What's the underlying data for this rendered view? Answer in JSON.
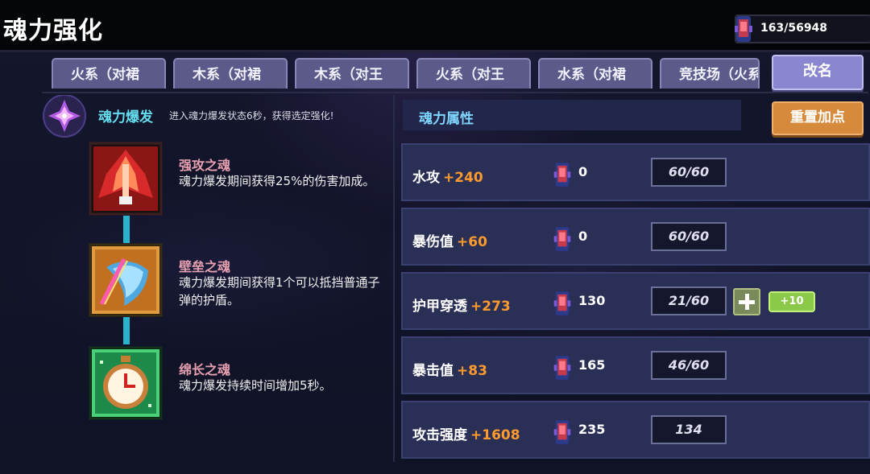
{
  "header": {
    "title": "魂力强化",
    "currency": "163/56948"
  },
  "tabs": [
    "火系（对裙",
    "木系（对裙",
    "木系（对王",
    "火系（对王",
    "水系（对裙",
    "竞技场（火系"
  ],
  "rename_label": "改名",
  "burst": {
    "label": "魂力爆发",
    "desc": "进入魂力爆发状态6秒，获得选定强化!"
  },
  "skills": [
    {
      "name": "强攻之魂",
      "desc": "魂力爆发期间获得25%的伤害加成。",
      "icon": "flame-ship-icon"
    },
    {
      "name": "壁垒之魂",
      "desc": "魂力爆发期间获得1个可以抵挡普通子弹的护盾。",
      "icon": "shield-icon"
    },
    {
      "name": "绵长之魂",
      "desc": "魂力爆发持续时间增加5秒。",
      "icon": "stopwatch-icon"
    }
  ],
  "attrs": {
    "header": "魂力属性",
    "reset_label": "重置加点",
    "rows": [
      {
        "name": "水攻",
        "bonus": "+240",
        "cost": "0",
        "level": "60/60"
      },
      {
        "name": "暴伤值",
        "bonus": "+60",
        "cost": "0",
        "level": "60/60"
      },
      {
        "name": "护甲穿透",
        "bonus": "+273",
        "cost": "130",
        "level": "21/60",
        "plus10": "+10"
      },
      {
        "name": "暴击值",
        "bonus": "+83",
        "cost": "165",
        "level": "46/60"
      },
      {
        "name": "攻击强度",
        "bonus": "+1608",
        "cost": "235",
        "level": "134"
      }
    ]
  },
  "colors": {
    "accent": "#28b4cc",
    "bonus": "#ff9a2e",
    "tab": "#5b5a8a",
    "reset": "#d68a3c"
  }
}
